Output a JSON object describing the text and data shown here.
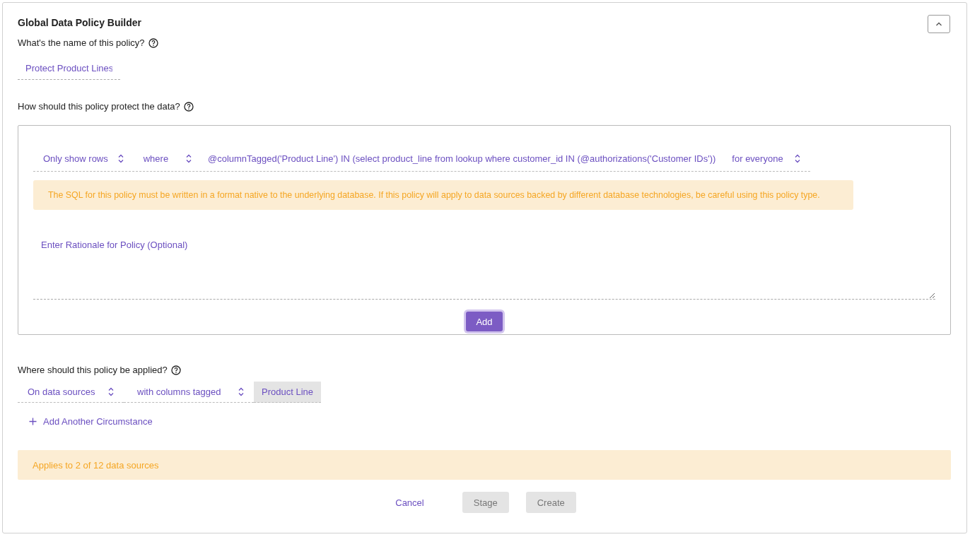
{
  "header": {
    "title": "Global Data Policy Builder"
  },
  "name_section": {
    "question": "What's the name of this policy?",
    "value": "Protect Product Lines"
  },
  "protect_section": {
    "question": "How should this policy protect the data?",
    "rule": [
      {
        "kind": "select",
        "value": "Only show rows"
      },
      {
        "kind": "select",
        "value": "where"
      },
      {
        "kind": "text",
        "value": "@columnTagged('Product Line') IN (select product_line from lookup where customer_id IN (@authorizations('Customer IDs'))"
      },
      {
        "kind": "select",
        "value": "for everyone"
      }
    ],
    "warning": "The SQL for this policy must be written in a format native to the underlying database. If this policy will apply to data sources backed by different database technologies, be careful using this policy type.",
    "rationale": {
      "placeholder": "Enter Rationale for Policy (Optional)"
    },
    "add_button": "Add"
  },
  "apply_section": {
    "question": "Where should this policy be applied?",
    "conditions": [
      {
        "kind": "select",
        "value": "On data sources"
      },
      {
        "kind": "select",
        "value": "with columns tagged"
      },
      {
        "kind": "tag",
        "value": "Product Line"
      }
    ],
    "add_link": "Add Another Circumstance"
  },
  "summary": "Applies to 2 of 12 data sources",
  "footer": {
    "buttons": [
      {
        "kind": "link",
        "label": "Cancel",
        "disabled": false
      },
      {
        "kind": "button",
        "label": "Stage",
        "disabled": true
      },
      {
        "kind": "button",
        "label": "Create",
        "disabled": true
      }
    ]
  }
}
